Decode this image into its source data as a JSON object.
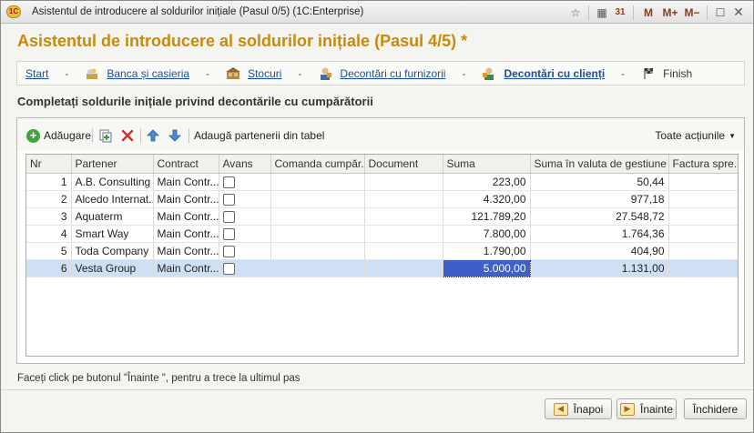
{
  "window": {
    "title": "Asistentul de introducere al soldurilor inițiale (Pasul 0/5)  (1C:Enterprise)",
    "logo_text": "1C",
    "toolbar_m": "M",
    "toolbar_m_plus": "M+",
    "toolbar_m_minus": "M−",
    "calendar_day": "31"
  },
  "heading": "Asistentul de introducere al soldurilor inițiale (Pasul 4/5) *",
  "steps": [
    {
      "label": "Start"
    },
    {
      "label": "Banca și casieria"
    },
    {
      "label": "Stocuri"
    },
    {
      "label": "Decontări cu furnizorii"
    },
    {
      "label": "Decontări cu clienți"
    },
    {
      "label": "Finish"
    }
  ],
  "step_separator": "-",
  "section_title": "Completați soldurile inițiale privind decontările cu cumpărătorii",
  "toolbar": {
    "add_label": "Adăugare",
    "fill_label": "Adaugă partenerii din tabel",
    "all_actions_label": "Toate acțiunile"
  },
  "table": {
    "columns": [
      "Nr",
      "Partener",
      "Contract",
      "Avans",
      "Comanda cumpăr...",
      "Document",
      "Suma",
      "Suma în valuta de gestiune",
      "Factura spre..."
    ],
    "rows": [
      {
        "nr": "1",
        "partner": "A.B. Consulting",
        "contract": "Main Contr...",
        "order": "",
        "document": "",
        "sum": "223,00",
        "sum_mgmt": "50,44",
        "invoice": ""
      },
      {
        "nr": "2",
        "partner": "Alcedo Internat...",
        "contract": "Main Contr...",
        "order": "",
        "document": "",
        "sum": "4.320,00",
        "sum_mgmt": "977,18",
        "invoice": ""
      },
      {
        "nr": "3",
        "partner": "Aquaterm",
        "contract": "Main Contr...",
        "order": "",
        "document": "",
        "sum": "121.789,20",
        "sum_mgmt": "27.548,72",
        "invoice": ""
      },
      {
        "nr": "4",
        "partner": "Smart Way",
        "contract": "Main Contr...",
        "order": "",
        "document": "",
        "sum": "7.800,00",
        "sum_mgmt": "1.764,36",
        "invoice": ""
      },
      {
        "nr": "5",
        "partner": "Toda Company",
        "contract": "Main Contr...",
        "order": "",
        "document": "",
        "sum": "1.790,00",
        "sum_mgmt": "404,90",
        "invoice": ""
      },
      {
        "nr": "6",
        "partner": "Vesta Group",
        "contract": "Main Contr...",
        "order": "",
        "document": "",
        "sum": "5.000,00",
        "sum_mgmt": "1.131,00",
        "invoice": ""
      }
    ]
  },
  "hint": "Faceți click pe butonul \"Înainte \", pentru a trece la ultimul pas",
  "buttons": {
    "back": "Înapoi",
    "next": "Înainte",
    "close": "Închidere"
  },
  "colors": {
    "heading": "#c98a0c",
    "link": "#1a4fa0",
    "selected_row": "#cfe0f5",
    "focused_cell": "#3e5fc8"
  }
}
